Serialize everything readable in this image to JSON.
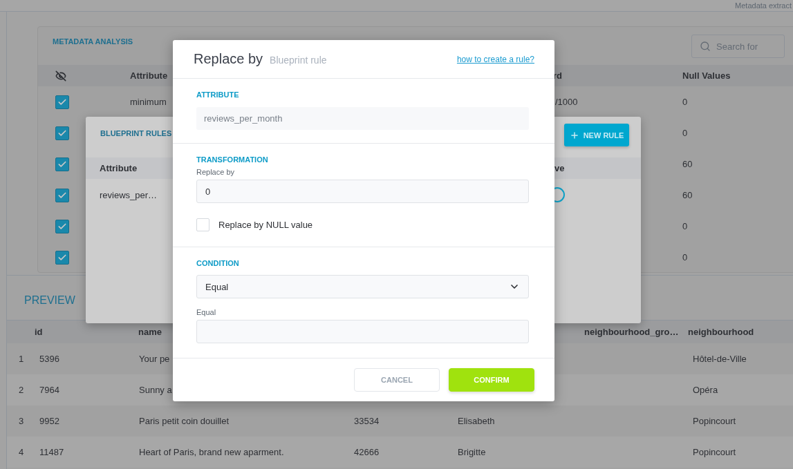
{
  "top_bar": {
    "text": "Metadata extract"
  },
  "metadata_analysis": {
    "title": "METADATA ANALYSIS",
    "search": {
      "placeholder": "Search for"
    },
    "columns": [
      "Attribute",
      "rd",
      "Null Values"
    ],
    "rows": [
      {
        "checked": true,
        "attribute": "minimum",
        "column_3": "/1000",
        "null_values": "0"
      },
      {
        "checked": true,
        "null_values": "0"
      },
      {
        "checked": true,
        "null_values": "60"
      },
      {
        "checked": true,
        "null_values": "60"
      },
      {
        "checked": true,
        "null_values": "0"
      },
      {
        "checked": true,
        "null_values": "0"
      }
    ]
  },
  "preview": {
    "title": "PREVIEW",
    "columns": [
      "id",
      "name",
      "neighbourhood_gro…",
      "neighbourhood"
    ],
    "rows": [
      {
        "index": "1",
        "id": "5396",
        "name": "Your pe",
        "neighbourhood": "Hôtel-de-Ville"
      },
      {
        "index": "2",
        "id": "7964",
        "name": "Sunny a",
        "neighbourhood": "Opéra"
      },
      {
        "index": "3",
        "id": "9952",
        "name": "Paris petit coin douillet",
        "column_4": "33534",
        "column_5": "Elisabeth",
        "neighbourhood": "Popincourt"
      },
      {
        "index": "4",
        "id": "11487",
        "name": "Heart of Paris, brand new aparment.",
        "column_4": "42666",
        "column_5": "Brigitte",
        "neighbourhood": "Popincourt"
      }
    ]
  },
  "blueprint_rules": {
    "title": "BLUEPRINT RULES",
    "new_rule_button": "NEW RULE",
    "columns": [
      "Attribute",
      "ve"
    ],
    "rows": [
      {
        "attribute": "reviews_per…"
      }
    ]
  },
  "dialog": {
    "title": "Replace by",
    "subtitle": "Blueprint rule",
    "help_link": "how to create a rule?",
    "attribute": {
      "label": "ATTRIBUTE",
      "value": "reviews_per_month"
    },
    "transformation": {
      "label": "TRANSFORMATION",
      "field_label": "Replace by",
      "value": "0",
      "null_checkbox": {
        "label": "Replace by NULL value",
        "checked": false
      }
    },
    "condition": {
      "label": "CONDITION",
      "operator": "Equal",
      "field_label": "Equal"
    },
    "buttons": {
      "cancel": "CANCEL",
      "confirm": "CONFIRM"
    }
  }
}
